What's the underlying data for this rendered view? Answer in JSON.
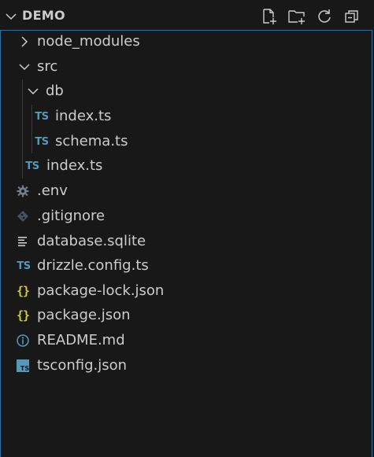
{
  "header": {
    "title": "DEMO",
    "actions": [
      {
        "name": "new-file",
        "icon": "new-file-icon"
      },
      {
        "name": "new-folder",
        "icon": "new-folder-icon"
      },
      {
        "name": "refresh",
        "icon": "refresh-icon"
      },
      {
        "name": "collapse-all",
        "icon": "collapse-all-icon"
      }
    ]
  },
  "tree": {
    "node_modules": "node_modules",
    "src": "src",
    "db": "db",
    "db_index": "index.ts",
    "db_schema": "schema.ts",
    "src_index": "index.ts",
    "env": ".env",
    "gitignore": ".gitignore",
    "database": "database.sqlite",
    "drizzle": "drizzle.config.ts",
    "package_lock": "package-lock.json",
    "package": "package.json",
    "readme": "README.md",
    "tsconfig": "tsconfig.json"
  },
  "icons": {
    "ts_label": "TS",
    "json_label": "{}",
    "ts_color": "#519aba",
    "json_color": "#cbcb41",
    "env_color": "#6d8086",
    "git_color": "#41535b",
    "readme_color": "#519aba",
    "tsconfig_color": "#519aba"
  }
}
